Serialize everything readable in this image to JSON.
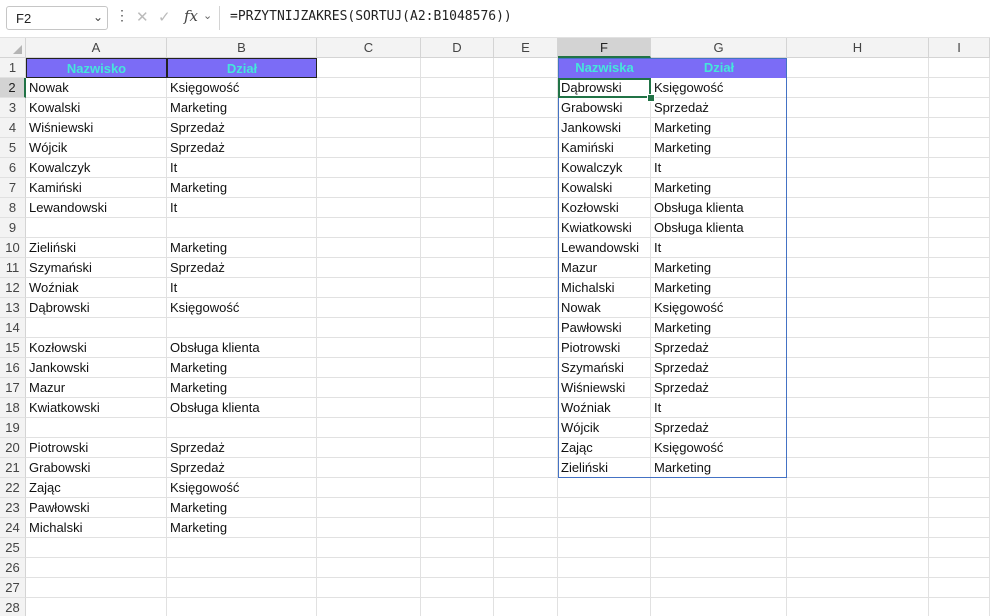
{
  "formula_bar": {
    "name_box": "F2",
    "fx_label": "fx",
    "formula": "=PRZYTNIJZAKRES(SORTUJ(A2:B1048576))"
  },
  "columns": [
    "A",
    "B",
    "C",
    "D",
    "E",
    "F",
    "G",
    "H",
    "I"
  ],
  "selected_cell": "F2",
  "rows": [
    "1",
    "2",
    "3",
    "4",
    "5",
    "6",
    "7",
    "8",
    "9",
    "10",
    "11",
    "12",
    "13",
    "14",
    "15",
    "16",
    "17",
    "18",
    "19",
    "20",
    "21",
    "22",
    "23",
    "24",
    "25",
    "26",
    "27",
    "28"
  ],
  "source_table": {
    "headers": [
      "Nazwisko",
      "Dział"
    ],
    "rows": [
      [
        "Nowak",
        "Księgowość"
      ],
      [
        "Kowalski",
        "Marketing"
      ],
      [
        "Wiśniewski",
        "Sprzedaż"
      ],
      [
        "Wójcik",
        "Sprzedaż"
      ],
      [
        "Kowalczyk",
        "It"
      ],
      [
        "Kamiński",
        "Marketing"
      ],
      [
        "Lewandowski",
        "It"
      ],
      [
        "",
        ""
      ],
      [
        "Zieliński",
        "Marketing"
      ],
      [
        "Szymański",
        "Sprzedaż"
      ],
      [
        "Woźniak",
        "It"
      ],
      [
        "Dąbrowski",
        "Księgowość"
      ],
      [
        "",
        ""
      ],
      [
        "Kozłowski",
        "Obsługa klienta"
      ],
      [
        "Jankowski",
        "Marketing"
      ],
      [
        "Mazur",
        "Marketing"
      ],
      [
        "Kwiatkowski",
        "Obsługa klienta"
      ],
      [
        "",
        ""
      ],
      [
        "Piotrowski",
        "Sprzedaż"
      ],
      [
        "Grabowski",
        "Sprzedaż"
      ],
      [
        "Zając",
        "Księgowość"
      ],
      [
        "Pawłowski",
        "Marketing"
      ],
      [
        "Michalski",
        "Marketing"
      ]
    ]
  },
  "result_table": {
    "headers": [
      "Nazwiska",
      "Dział"
    ],
    "rows": [
      [
        "Dąbrowski",
        "Księgowość"
      ],
      [
        "Grabowski",
        "Sprzedaż"
      ],
      [
        "Jankowski",
        "Marketing"
      ],
      [
        "Kamiński",
        "Marketing"
      ],
      [
        "Kowalczyk",
        "It"
      ],
      [
        "Kowalski",
        "Marketing"
      ],
      [
        "Kozłowski",
        "Obsługa klienta"
      ],
      [
        "Kwiatkowski",
        "Obsługa klienta"
      ],
      [
        "Lewandowski",
        "It"
      ],
      [
        "Mazur",
        "Marketing"
      ],
      [
        "Michalski",
        "Marketing"
      ],
      [
        "Nowak",
        "Księgowość"
      ],
      [
        "Pawłowski",
        "Marketing"
      ],
      [
        "Piotrowski",
        "Sprzedaż"
      ],
      [
        "Szymański",
        "Sprzedaż"
      ],
      [
        "Wiśniewski",
        "Sprzedaż"
      ],
      [
        "Woźniak",
        "It"
      ],
      [
        "Wójcik",
        "Sprzedaż"
      ],
      [
        "Zając",
        "Księgowość"
      ],
      [
        "Zieliński",
        "Marketing"
      ]
    ]
  },
  "colors": {
    "header_fill": "#7b6cf6",
    "header_text": "#45e6da",
    "selection": "#217346",
    "spill_border": "#4472c4"
  }
}
